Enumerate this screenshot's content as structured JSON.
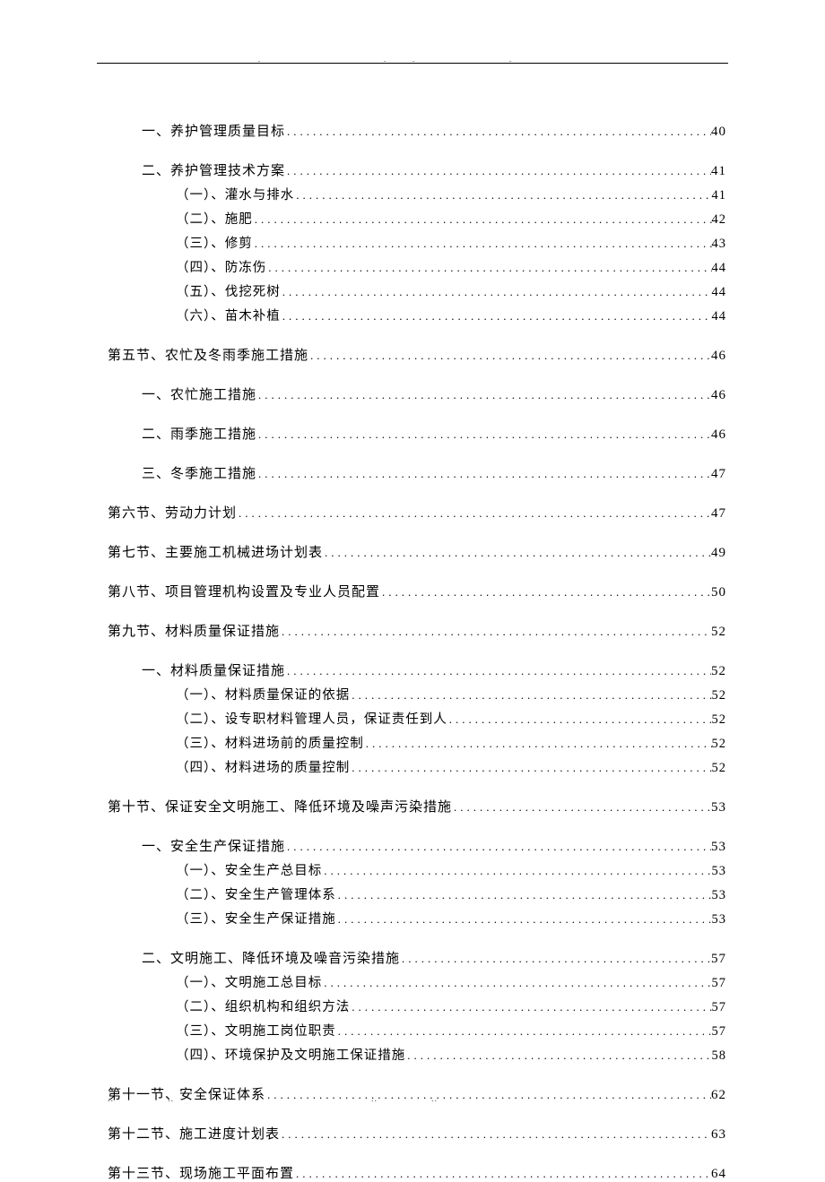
{
  "toc": [
    {
      "level": 1,
      "label": "一、养护管理质量目标",
      "page": "40"
    },
    {
      "level": 1,
      "label": "二、养护管理技术方案",
      "page": "41"
    },
    {
      "level": 2,
      "label": "（一）、灌水与排水",
      "page": "41"
    },
    {
      "level": 2,
      "label": "（二）、施肥",
      "page": "42"
    },
    {
      "level": 2,
      "label": "（三）、修剪",
      "page": "43"
    },
    {
      "level": 2,
      "label": "（四）、防冻伤",
      "page": "44"
    },
    {
      "level": 2,
      "label": "（五）、伐挖死树",
      "page": "44"
    },
    {
      "level": 2,
      "label": "（六）、苗木补植",
      "page": "44"
    },
    {
      "level": 0,
      "label": "第五节、农忙及冬雨季施工措施",
      "page": "46"
    },
    {
      "level": 1,
      "label": "一、农忙施工措施",
      "page": "46"
    },
    {
      "level": 1,
      "label": "二、雨季施工措施",
      "page": "46"
    },
    {
      "level": 1,
      "label": "三、冬季施工措施",
      "page": "47"
    },
    {
      "level": 0,
      "label": "第六节、劳动力计划",
      "page": "47"
    },
    {
      "level": 0,
      "label": "第七节、主要施工机械进场计划表",
      "page": "49"
    },
    {
      "level": 0,
      "label": "第八节、项目管理机构设置及专业人员配置",
      "page": "50"
    },
    {
      "level": 0,
      "label": "第九节、材料质量保证措施",
      "page": "52"
    },
    {
      "level": 1,
      "label": "一、材料质量保证措施",
      "page": "52"
    },
    {
      "level": 2,
      "label": "（一）、材料质量保证的依据",
      "page": "52"
    },
    {
      "level": 2,
      "label": "（二）、设专职材料管理人员，保证责任到人",
      "page": "52"
    },
    {
      "level": 2,
      "label": "（三）、材料进场前的质量控制",
      "page": "52"
    },
    {
      "level": 2,
      "label": "（四）、材料进场的质量控制",
      "page": "52"
    },
    {
      "level": 0,
      "label": "第十节、保证安全文明施工、降低环境及噪声污染措施",
      "page": "53"
    },
    {
      "level": 1,
      "label": "一、安全生产保证措施",
      "page": "53"
    },
    {
      "level": 2,
      "label": "（一）、安全生产总目标",
      "page": "53"
    },
    {
      "level": 2,
      "label": "（二）、安全生产管理体系",
      "page": "53"
    },
    {
      "level": 2,
      "label": "（三）、安全生产保证措施",
      "page": "53"
    },
    {
      "level": 1,
      "label": "二、文明施工、降低环境及噪音污染措施",
      "page": "57"
    },
    {
      "level": 2,
      "label": "（一）、文明施工总目标",
      "page": "57"
    },
    {
      "level": 2,
      "label": "（二）、组织机构和组织方法",
      "page": "57"
    },
    {
      "level": 2,
      "label": "（三）、文明施工岗位职责",
      "page": "57"
    },
    {
      "level": 2,
      "label": "（四）、环境保护及文明施工保证措施",
      "page": "58"
    },
    {
      "level": 0,
      "label": "第十一节、安全保证体系",
      "page": "62"
    },
    {
      "level": 0,
      "label": "第十二节、施工进度计划表",
      "page": "63"
    },
    {
      "level": 0,
      "label": "第十三节、现场施工平面布置",
      "page": "64"
    }
  ],
  "footer": {
    "m1": "..",
    "m2": "..",
    "m3": "..",
    "m4": ".."
  },
  "header_marks": [
    ".",
    "..",
    "."
  ]
}
